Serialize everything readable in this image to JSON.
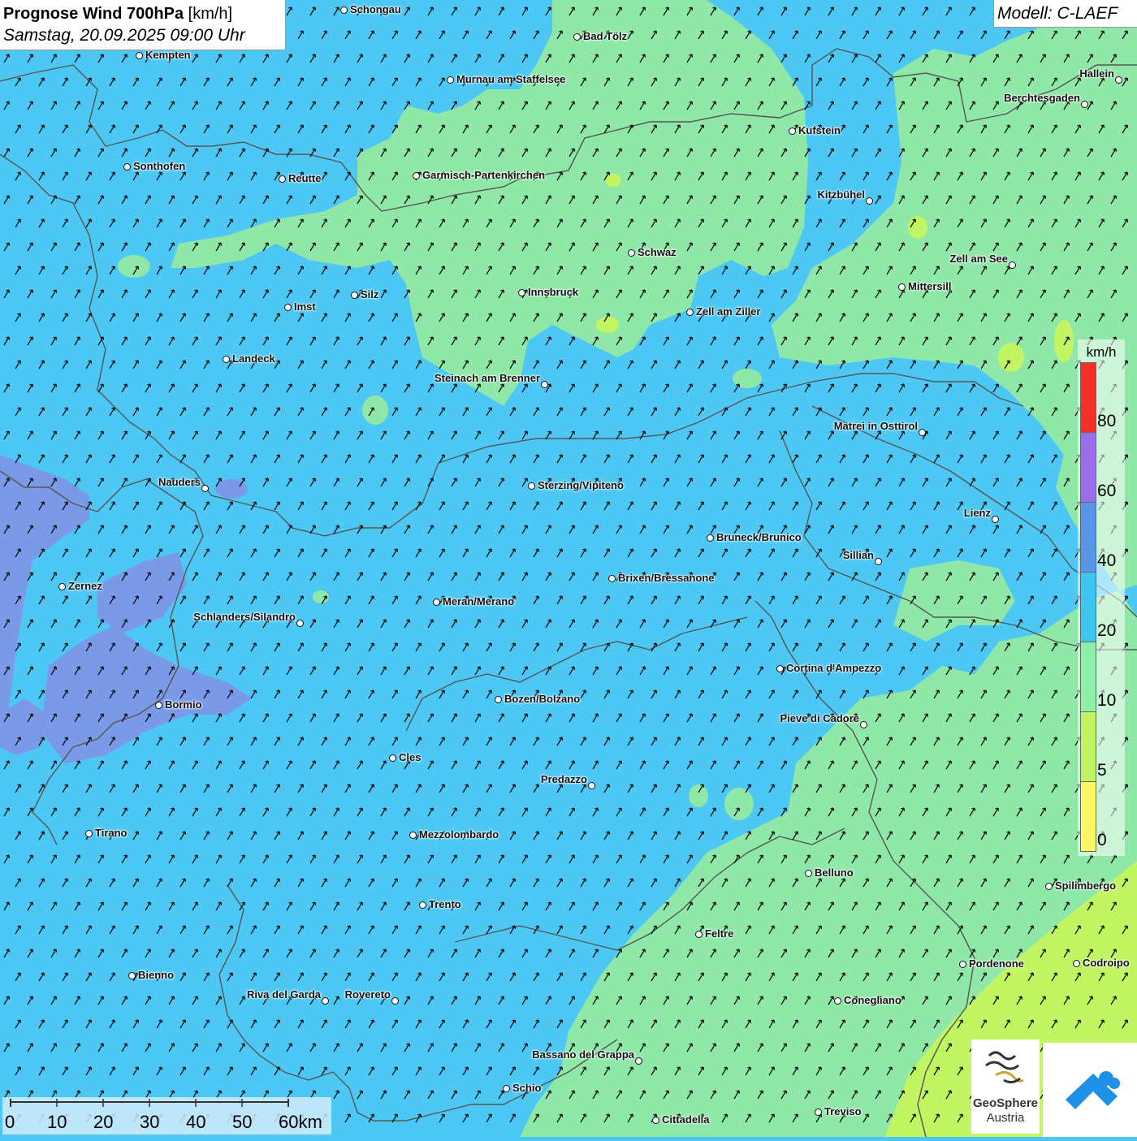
{
  "header": {
    "title_bold": "Prognose Wind 700hPa",
    "title_unit": "[km/h]",
    "subtitle": "Samstag, 20.09.2025 09:00 Uhr",
    "model": "Modell: C-LAEF"
  },
  "legend": {
    "unit": "km/h",
    "items": [
      {
        "label": "80",
        "color": "#f5302a"
      },
      {
        "label": "60",
        "color": "#9a6ee8"
      },
      {
        "label": "40",
        "color": "#5a96e8"
      },
      {
        "label": "20",
        "color": "#3ec6f2"
      },
      {
        "label": "10",
        "color": "#8ef0a6"
      },
      {
        "label": "5",
        "color": "#c2f562"
      },
      {
        "label": "0",
        "color": "#fbf765"
      }
    ]
  },
  "scale_bar": {
    "ticks": [
      "0",
      "10",
      "20",
      "30",
      "40",
      "50",
      "60km"
    ]
  },
  "logos": {
    "geosphere_line1": "GeoSphere",
    "geosphere_line2": "Austria"
  },
  "map": {
    "colors": {
      "base": "#4dc8f5",
      "green": "#90e8a8",
      "yellow_green": "#c2f562",
      "yellow": "#f8f080",
      "blue": "#5d9be8",
      "purple": "#8a8ee8",
      "border": "#555555"
    },
    "arrow_icon": "wind-arrow-icon",
    "cities": [
      {
        "name": "Schongau",
        "side": "r"
      },
      {
        "name": "Bad Tölz",
        "side": "r"
      },
      {
        "name": "Kempten",
        "side": "r"
      },
      {
        "name": "Murnau am Staffelsee",
        "side": "r"
      },
      {
        "name": "Hallein",
        "side": "l"
      },
      {
        "name": "Berchtesgaden",
        "side": "l"
      },
      {
        "name": "Kufstein",
        "side": "r"
      },
      {
        "name": "Sonthofen",
        "side": "r"
      },
      {
        "name": "Reutte",
        "side": "r"
      },
      {
        "name": "Garmisch-Partenkirchen",
        "side": "r"
      },
      {
        "name": "Kitzbühel",
        "side": "l"
      },
      {
        "name": "Schwaz",
        "side": "r"
      },
      {
        "name": "Zell am See",
        "side": "l"
      },
      {
        "name": "Mittersill",
        "side": "r"
      },
      {
        "name": "Innsbruck",
        "side": "r"
      },
      {
        "name": "Silz",
        "side": "r"
      },
      {
        "name": "Imst",
        "side": "r"
      },
      {
        "name": "Zell am Ziller",
        "side": "r"
      },
      {
        "name": "Landeck",
        "side": "r"
      },
      {
        "name": "Steinach am Brenner",
        "side": "l"
      },
      {
        "name": "Matrei in Osttirol",
        "side": "l"
      },
      {
        "name": "Nauders",
        "side": "l"
      },
      {
        "name": "Sterzing/Vipiteno",
        "side": "r"
      },
      {
        "name": "Lienz",
        "side": "l"
      },
      {
        "name": "Bruneck/Brunico",
        "side": "r"
      },
      {
        "name": "Sillian",
        "side": "l"
      },
      {
        "name": "Brixen/Bressanone",
        "side": "r"
      },
      {
        "name": "Zernez",
        "side": "r"
      },
      {
        "name": "Meran/Merano",
        "side": "r"
      },
      {
        "name": "Schlanders/Silandro",
        "side": "l"
      },
      {
        "name": "Cortina d'Ampezzo",
        "side": "r"
      },
      {
        "name": "Bozen/Bolzano",
        "side": "r"
      },
      {
        "name": "Bormio",
        "side": "r"
      },
      {
        "name": "Pieve di Cadore",
        "side": "l"
      },
      {
        "name": "Cles",
        "side": "r"
      },
      {
        "name": "Predazzo",
        "side": "l"
      },
      {
        "name": "Tirano",
        "side": "r"
      },
      {
        "name": "Mezzolombardo",
        "side": "r"
      },
      {
        "name": "Belluno",
        "side": "r"
      },
      {
        "name": "Spilimbergo",
        "side": "r"
      },
      {
        "name": "Trento",
        "side": "r"
      },
      {
        "name": "Feltre",
        "side": "r"
      },
      {
        "name": "Bienno",
        "side": "r"
      },
      {
        "name": "Pordenone",
        "side": "r"
      },
      {
        "name": "Codroipo",
        "side": "r"
      },
      {
        "name": "Riva del Garda",
        "side": "l"
      },
      {
        "name": "Rovereto",
        "side": "l"
      },
      {
        "name": "Conegliano",
        "side": "r"
      },
      {
        "name": "Bassano del Grappa",
        "side": "l"
      },
      {
        "name": "Schio",
        "side": "r"
      },
      {
        "name": "Treviso",
        "side": "r"
      },
      {
        "name": "Cittadella",
        "side": "r"
      }
    ]
  }
}
